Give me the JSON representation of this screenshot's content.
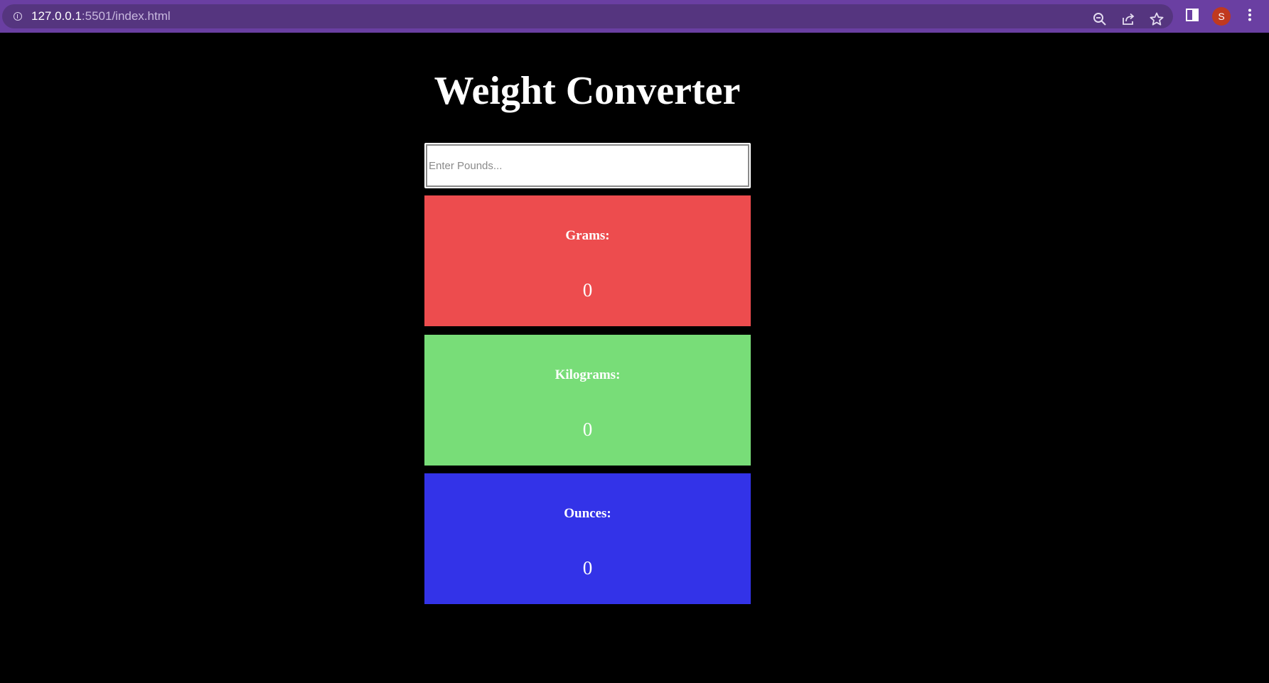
{
  "browser": {
    "url_host": "127.0.0.1",
    "url_path": ":5501/index.html",
    "avatar_initial": "S",
    "icons": [
      "info-icon",
      "zoom-icon",
      "share-icon",
      "star-icon",
      "side-panel-icon",
      "menu-dots-icon"
    ],
    "accent_color": "#6a3fa2"
  },
  "page": {
    "title": "Weight Converter",
    "input": {
      "placeholder": "Enter Pounds...",
      "value": ""
    },
    "cards": [
      {
        "label": "Grams:",
        "value": "0",
        "color": "#ed4c4e"
      },
      {
        "label": "Kilograms:",
        "value": "0",
        "color": "#78dd78"
      },
      {
        "label": "Ounces:",
        "value": "0",
        "color": "#3333e8"
      }
    ]
  }
}
